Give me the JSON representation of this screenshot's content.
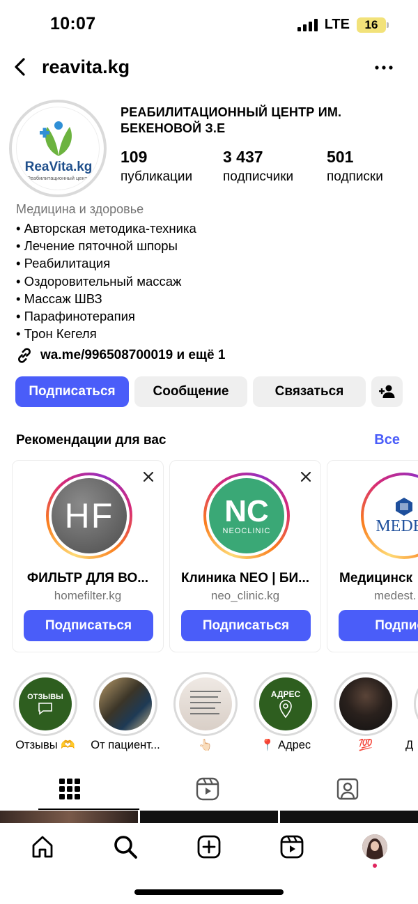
{
  "status_bar": {
    "time": "10:07",
    "network": "LTE",
    "battery": "16"
  },
  "header": {
    "username": "reavita.kg",
    "back_icon": "chevron-left-icon",
    "more_icon": "more-horizontal-icon"
  },
  "profile": {
    "display_name": "РЕАБИЛИТАЦИОННЫЙ ЦЕНТР ИМ. БЕКЕНОВОЙ З.Е",
    "logo_text": "ReaVita.kg",
    "logo_subtext": "Реабилитационный центр",
    "stats": [
      {
        "value": "109",
        "label": "публикации"
      },
      {
        "value": "3 437",
        "label": "подписчики"
      },
      {
        "value": "501",
        "label": "подписки"
      }
    ],
    "category": "Медицина и здоровье",
    "bio": [
      "• Авторская методика-техника",
      "• Лечение пяточной шпоры",
      "• Реабилитация",
      "• Оздоровительный массаж",
      "• Массаж ШВЗ",
      "• Парафинотерапия",
      "• Трон Кегеля"
    ],
    "link": "wa.me/996508700019 и ещё 1"
  },
  "actions": {
    "follow": "Подписаться",
    "message": "Сообщение",
    "contact": "Связаться"
  },
  "recommendations": {
    "title": "Рекомендации для вас",
    "see_all": "Все",
    "cards": [
      {
        "name": "ФИЛЬТР ДЛЯ ВО...",
        "handle": "homefilter.kg",
        "button": "Подписаться",
        "logo": "HF"
      },
      {
        "name": "Клиника NEO | БИ...",
        "handle": "neo_clinic.kg",
        "button": "Подписаться",
        "logo": "NC",
        "logo_sub": "NEOCLINIC"
      },
      {
        "name": "Медицинск",
        "handle": "medest.",
        "button": "Подписа",
        "logo": "MEDES"
      }
    ]
  },
  "highlights": [
    {
      "label": "Отзывы 🫶",
      "badge": "ОТЗЫВЫ"
    },
    {
      "label": "От пациент..."
    },
    {
      "label": "👆🏻"
    },
    {
      "label": "📍 Адрес",
      "badge": "АДРЕС"
    },
    {
      "label": "💯"
    },
    {
      "label": "Д"
    }
  ],
  "colors": {
    "accent": "#4a5df9",
    "muted": "#737373",
    "green": "#2e5e1f"
  }
}
